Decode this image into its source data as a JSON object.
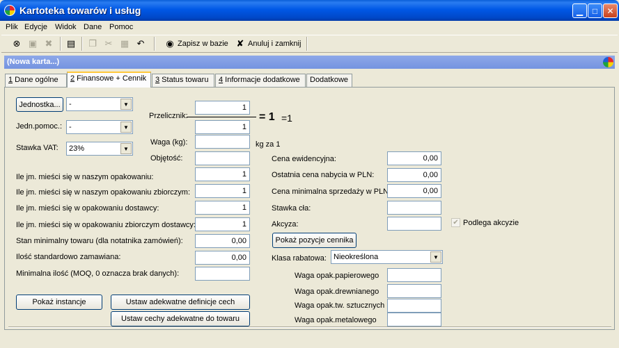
{
  "window": {
    "title": "Kartoteka towarów i usług"
  },
  "menu": [
    "Plik",
    "Edycje",
    "Widok",
    "Dane",
    "Pomoc"
  ],
  "toolbar": {
    "save_label": "Zapisz w bazie",
    "cancel_label": "Anuluj i zamknij"
  },
  "band": {
    "label": "(Nowa karta...)"
  },
  "tabs": [
    {
      "key": "1",
      "label": " Dane ogólne"
    },
    {
      "key": "2",
      "label": " Finansowe + Cennik"
    },
    {
      "key": "3",
      "label": " Status towaru"
    },
    {
      "key": "4",
      "label": " Informacje dodatkowe"
    },
    {
      "key": "",
      "label": "Dodatkowe"
    }
  ],
  "left": {
    "unit_button": "Jednostka...",
    "unit_value": "-",
    "aux_unit_label": "Jedn.pomoc.:",
    "aux_unit_value": "-",
    "vat_label": "Stawka VAT:",
    "vat_value": "23%"
  },
  "conversion": {
    "label": "Przelicznik:",
    "numerator": "1",
    "denominator": "1",
    "result_big": "= 1",
    "result_small": "=1"
  },
  "weight": {
    "label": "Waga (kg):",
    "value": "",
    "suffix": "kg za 1"
  },
  "volume": {
    "label": "Objętość:",
    "value": ""
  },
  "packing": [
    {
      "label": "Ile jm. mieści się w naszym opakowaniu:",
      "value": "1"
    },
    {
      "label": "Ile jm. mieści się w naszym opakowaniu zbiorczym:",
      "value": "1"
    },
    {
      "label": "Ile jm. mieści się w opakowaniu dostawcy:",
      "value": "1"
    },
    {
      "label": "Ile jm. mieści się w opakowaniu zbiorczym dostawcy:",
      "value": "1"
    },
    {
      "label": "Stan minimalny towaru (dla notatnika zamówień):",
      "value": "0,00"
    },
    {
      "label": "Ilość standardowo zamawiana:",
      "value": "0,00"
    },
    {
      "label": "Minimalna ilość (MOQ, 0 oznacza brak danych):",
      "value": ""
    }
  ],
  "prices": [
    {
      "label": "Cena ewidencyjna:",
      "value": "0,00"
    },
    {
      "label": "Ostatnia cena nabycia w PLN:",
      "value": "0,00"
    },
    {
      "label": "Cena minimalna sprzedaży w PLN:",
      "value": "0,00"
    },
    {
      "label": "Stawka cła:",
      "value": ""
    },
    {
      "label": "Akcyza:",
      "value": ""
    }
  ],
  "excise_check": {
    "label": "Podlega akcyzie",
    "checked": true
  },
  "show_price_positions": "Pokaż pozycje cennika",
  "discount": {
    "label": "Klasa rabatowa:",
    "value": "Nieokreślona"
  },
  "packaging_weights": [
    {
      "label": "Waga opak.papierowego",
      "value": ""
    },
    {
      "label": "Waga opak.drewnianego",
      "value": ""
    },
    {
      "label": "Waga opak.tw. sztucznych",
      "value": ""
    },
    {
      "label": "Waga opak.metalowego",
      "value": ""
    }
  ],
  "buttons": {
    "instances": "Pokaż instancje",
    "set_definitions": "Ustaw adekwatne definicje cech",
    "set_features": "Ustaw cechy adekwatne do towaru"
  },
  "colors": {
    "title_bar": "#0058e6",
    "band": "#7f9de4",
    "face": "#ece9d8"
  }
}
